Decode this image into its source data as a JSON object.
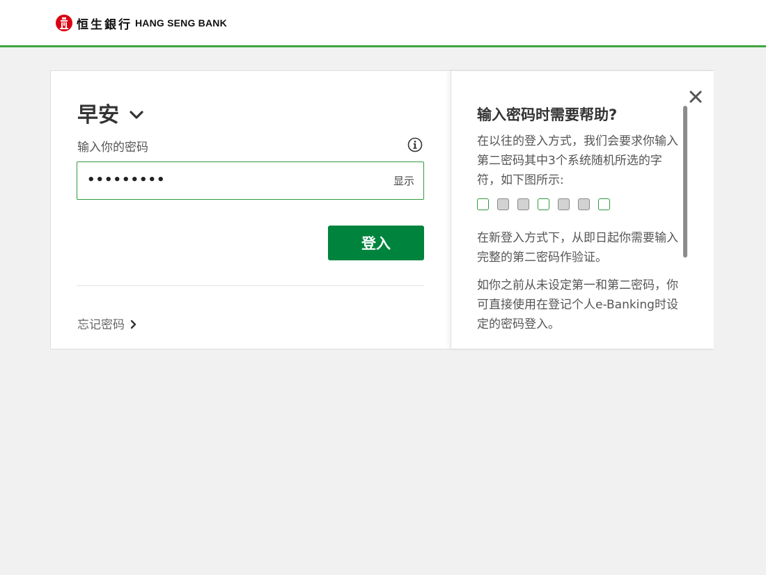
{
  "header": {
    "brand_cn": "恒生銀行",
    "brand_en": "HANG SENG BANK"
  },
  "login": {
    "greeting": "早安",
    "password_label": "输入你的密码",
    "password_value": "•••••••••",
    "show_label": "显示",
    "login_button": "登入",
    "forgot_password": "忘记密码"
  },
  "help": {
    "title": "输入密码时需要帮助?",
    "paragraph1": "在以往的登入方式，我们会要求你输入第二密码其中3个系统随机所选的字符，如下图所示:",
    "boxes": [
      "open",
      "filled",
      "filled",
      "open",
      "filled",
      "filled",
      "open"
    ],
    "paragraph2": "在新登入方式下，从即日起你需要输入完整的第二密码作验证。",
    "paragraph3": "如你之前从未设定第一和第二密码，你可直接使用在登记个人e-Banking时设定的密码登入。"
  },
  "colors": {
    "accent_green": "#00843d",
    "header_rule": "#3fa63f",
    "brand_red": "#db0011"
  }
}
